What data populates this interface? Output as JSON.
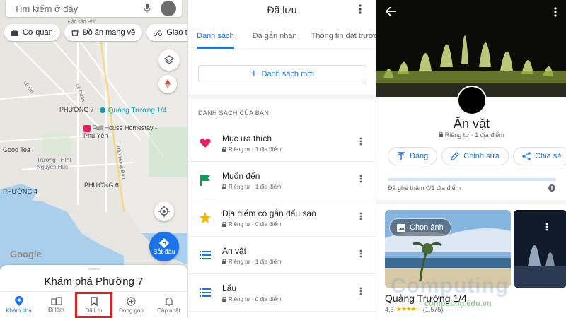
{
  "map": {
    "search_placeholder": "Tìm kiếm ở đây",
    "chips": [
      {
        "icon": "briefcase-icon",
        "label": "Cơ quan"
      },
      {
        "icon": "takeout-icon",
        "label": "Đồ ăn mang về"
      },
      {
        "icon": "motorbike-icon",
        "label": "Giao tận"
      }
    ],
    "labels": {
      "airport": "Đặc sản Phú",
      "ward7": "PHƯỜNG 7",
      "ward6": "PHƯỜNG 6",
      "ward4": "PHƯỜNG 4",
      "square": "Quảng Trường 1/4",
      "homestay": "Full House Homestay - Phú Yên",
      "goodtea": "Good Tea",
      "school": "Trường THPT Nguyễn Huệ",
      "street1": "Lê Lợi",
      "street2": "Lê Duẩn",
      "street3": "Trần Hưng Đạo"
    },
    "start_label": "Bắt đầu",
    "google": "Google",
    "sheet_title": "Khám phá Phường 7",
    "nav": [
      {
        "icon": "pin-icon",
        "label": "Khám phá"
      },
      {
        "icon": "commute-icon",
        "label": "Đi làm"
      },
      {
        "icon": "bookmark-icon",
        "label": "Đã lưu"
      },
      {
        "icon": "add-circle-icon",
        "label": "Đóng góp"
      },
      {
        "icon": "bell-icon",
        "label": "Cập nhật"
      }
    ]
  },
  "saved": {
    "title": "Đã lưu",
    "tabs": [
      "Danh sách",
      "Đã gắn nhãn",
      "Thông tin đặt trước"
    ],
    "new_list": "Danh sách mới",
    "section_title": "DANH SÁCH CỦA BẠN",
    "lists": [
      {
        "icon": "heart-icon",
        "color": "#e91e63",
        "name": "Mục ưa thích",
        "meta": "Riêng tư · 1 địa điểm"
      },
      {
        "icon": "flag-icon",
        "color": "#0f9d58",
        "name": "Muốn đến",
        "meta": "Riêng tư · 1 địa điểm"
      },
      {
        "icon": "star-icon",
        "color": "#f4b400",
        "name": "Địa điểm có gắn dấu sao",
        "meta": "Riêng tư · 0 địa điểm"
      },
      {
        "icon": "list-icon",
        "color": "#1a73e8",
        "name": "Ăn vặt",
        "meta": "Riêng tư · 1 địa điểm"
      },
      {
        "icon": "list-icon",
        "color": "#1a73e8",
        "name": "Lẩu",
        "meta": "Riêng tư · 0 địa điểm"
      }
    ]
  },
  "detail": {
    "title": "Ăn vặt",
    "meta": "Riêng tư · 1 địa điểm",
    "actions": [
      {
        "icon": "follow-icon",
        "label": "Đăng"
      },
      {
        "icon": "pencil-icon",
        "label": "Chỉnh sửa"
      },
      {
        "icon": "share-icon",
        "label": "Chia sẻ"
      }
    ],
    "visited": "Đã ghé thăm 0/1 địa điểm",
    "choose_photo": "Chọn ảnh",
    "place_name": "Quảng Trường 1/4",
    "rating": "4,3",
    "stars": "★★★★☆",
    "reviews": "(1.575)"
  },
  "watermark": {
    "text": "Computing",
    "url": "computing.edu.vn"
  }
}
